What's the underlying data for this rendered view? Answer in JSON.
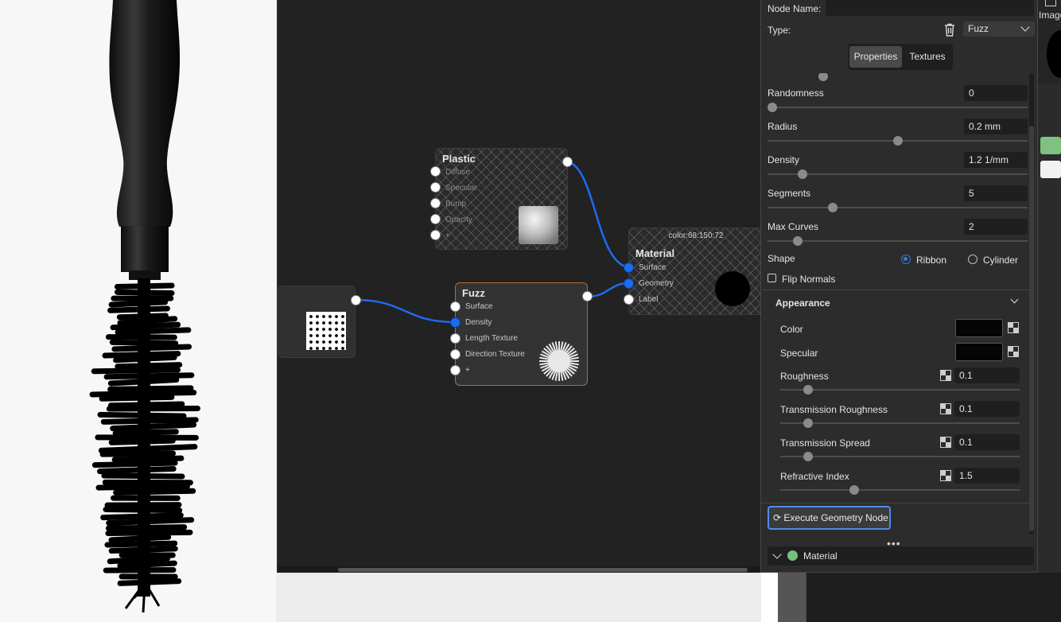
{
  "node_editor": {
    "nodes": {
      "plastic": {
        "title": "Plastic",
        "ports": [
          "Diffuse",
          "Specular",
          "Bump",
          "Opacity",
          "+"
        ]
      },
      "fuzz": {
        "title": "Fuzz",
        "ports": [
          "Surface",
          "Density",
          "Length Texture",
          "Direction Texture",
          "+"
        ]
      },
      "material": {
        "color_tag": "color:68:150:72",
        "title": "Material",
        "ports": [
          "Surface",
          "Geometry",
          "Label"
        ]
      }
    },
    "icons": {
      "texture": "dot-pattern-icon",
      "fuzz_preview": "starburst-icon",
      "plastic_preview": "sphere-icon"
    }
  },
  "panel": {
    "node_name_label": "Node Name:",
    "node_name_value": "",
    "type_label": "Type:",
    "type_value": "Fuzz",
    "tabs": [
      "Properties",
      "Textures"
    ],
    "active_tab": "Properties",
    "properties": [
      {
        "label": "Randomness",
        "value": "0",
        "slider": 0.0
      },
      {
        "label": "Radius",
        "value": "0.2 mm",
        "slider": 0.5
      },
      {
        "label": "Density",
        "value": "1.2 1/mm",
        "slider": 0.12
      },
      {
        "label": "Segments",
        "value": "5",
        "slider": 0.24
      },
      {
        "label": "Max Curves",
        "value": "2",
        "slider": 0.1
      }
    ],
    "shape": {
      "label": "Shape",
      "options": [
        "Ribbon",
        "Cylinder"
      ],
      "selected": "Ribbon"
    },
    "flip_normals": {
      "label": "Flip Normals",
      "checked": false
    },
    "appearance": {
      "header": "Appearance",
      "color": {
        "label": "Color",
        "value": "#050505"
      },
      "specular": {
        "label": "Specular",
        "value": "#050505"
      },
      "sliders": [
        {
          "label": "Roughness",
          "value": "0.1",
          "slider": 0.1
        },
        {
          "label": "Transmission Roughness",
          "value": "0.1",
          "slider": 0.1
        },
        {
          "label": "Transmission Spread",
          "value": "0.1",
          "slider": 0.1
        },
        {
          "label": "Refractive Index",
          "value": "1.5",
          "slider": 0.3
        }
      ]
    },
    "execute_button": "Execute Geometry Node",
    "more": "•••",
    "material_row": {
      "label": "Material",
      "dot_color": "#73c07d"
    }
  },
  "side": {
    "image_tab": "Image",
    "swatches": [
      "#7fc27f",
      "#f2f2f2"
    ]
  },
  "colors": {
    "accent": "#1c6cf0",
    "fuzz_border": "#b96a2c",
    "button_border": "#4f8de8"
  }
}
